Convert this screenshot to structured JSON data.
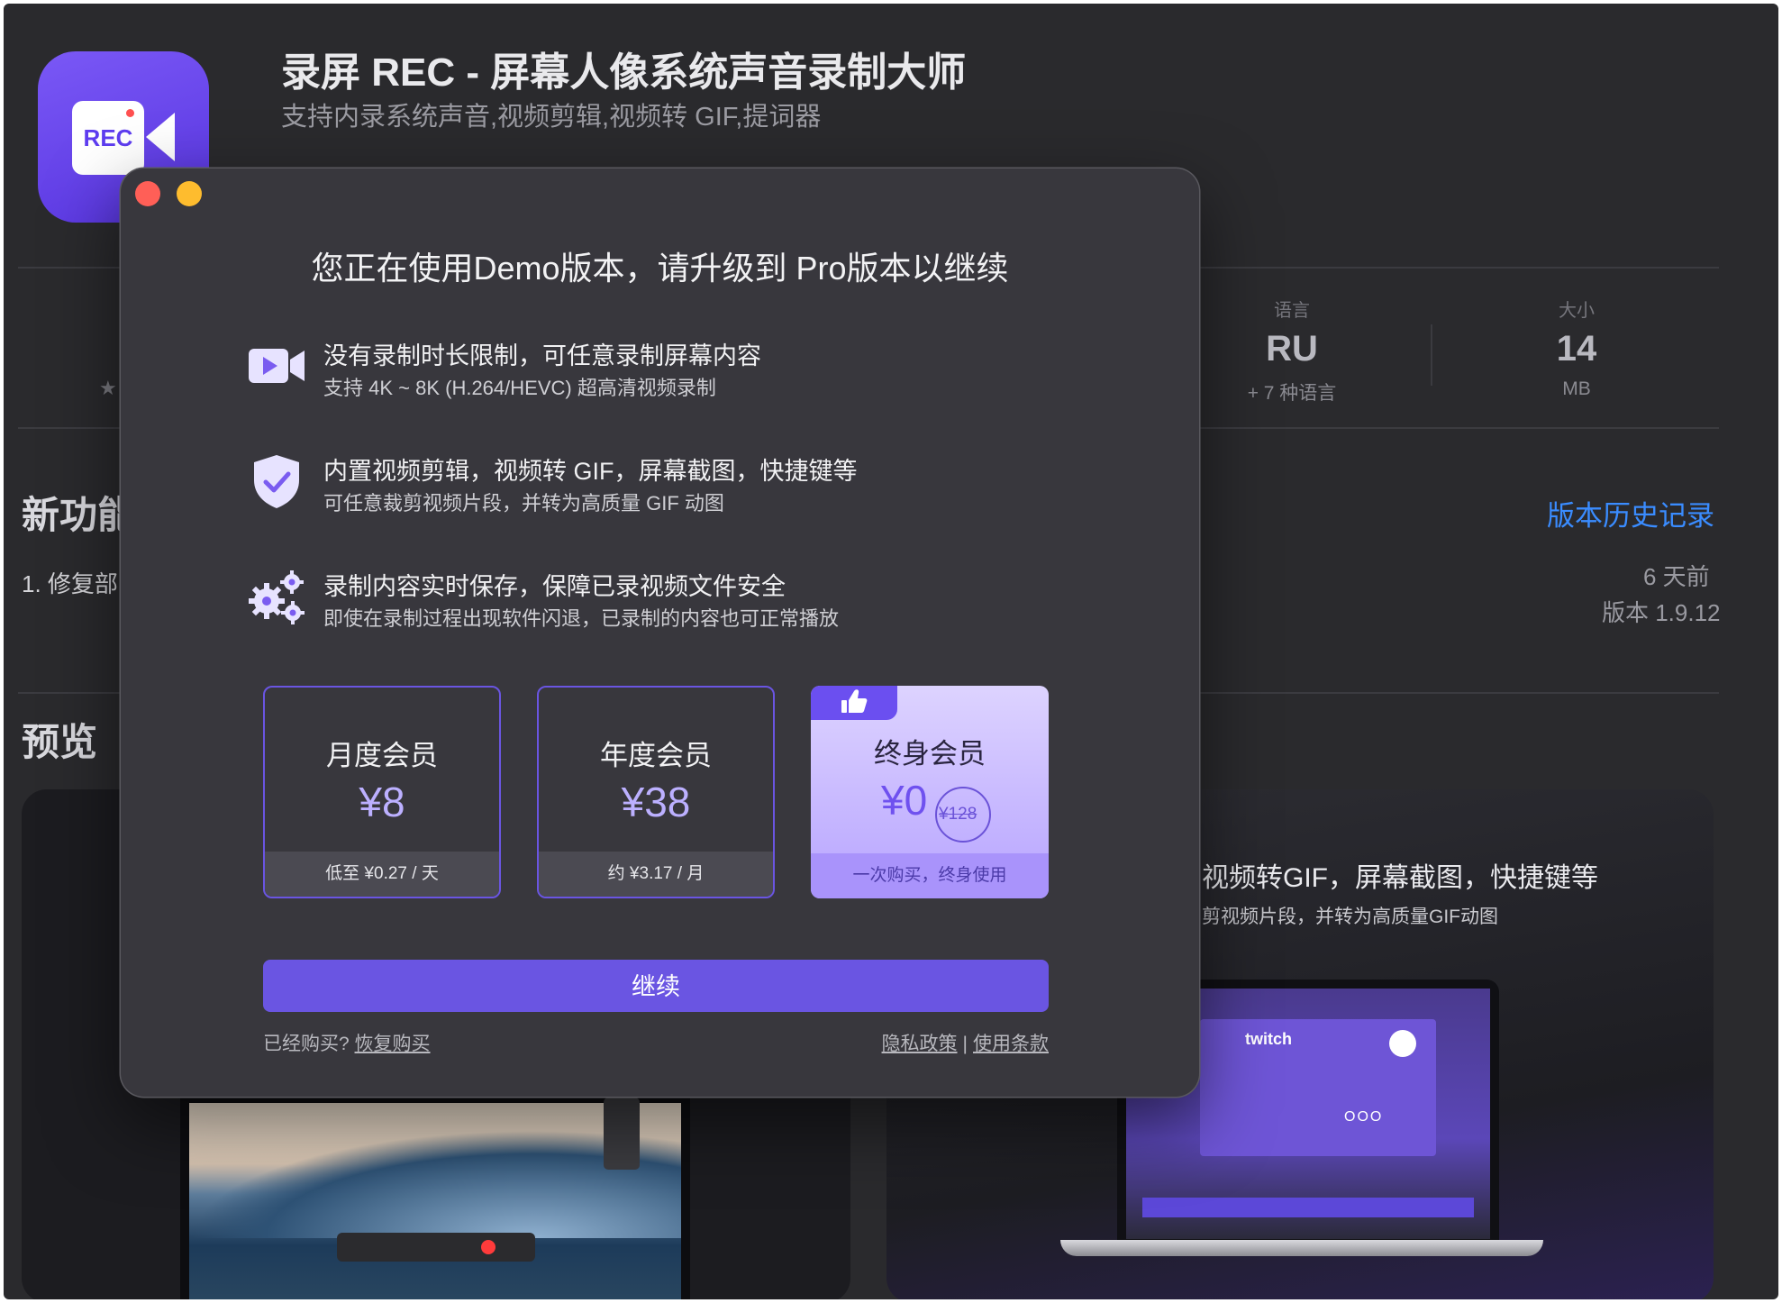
{
  "app": {
    "icon_text": "REC",
    "title": "录屏 REC - 屏幕人像系统声音录制大师",
    "subtitle": "支持内录系统声音,视频剪辑,视频转 GIF,提词器"
  },
  "stats": {
    "rating_star": "★",
    "language": {
      "label": "语言",
      "value": "RU",
      "sub": "+ 7 种语言"
    },
    "size": {
      "label": "大小",
      "value": "14",
      "sub": "MB"
    }
  },
  "whats_new": {
    "title": "新功能",
    "history_link": "版本历史记录",
    "first_item": "1. 修复部",
    "ago": "6 天前",
    "version": "版本 1.9.12"
  },
  "preview": {
    "title": "预览",
    "right_tile": {
      "heading": "视频转GIF，屏幕截图，快捷键等",
      "subheading": "剪视频片段，并转为高质量GIF动图"
    },
    "laptop_logo": "twitch",
    "laptop_dots": "OOO"
  },
  "modal": {
    "heading": "您正在使用Demo版本，请升级到 Pro版本以继续",
    "features": [
      {
        "icon": "video-camera-icon",
        "title": "没有录制时长限制，可任意录制屏幕内容",
        "desc": "支持 4K ~ 8K (H.264/HEVC) 超高清视频录制"
      },
      {
        "icon": "shield-check-icon",
        "title": "内置视频剪辑，视频转 GIF，屏幕截图，快捷键等",
        "desc": "可任意裁剪视频片段，并转为高质量 GIF 动图"
      },
      {
        "icon": "gears-icon",
        "title": "录制内容实时保存，保障已录视频文件安全",
        "desc": "即使在录制过程出现软件闪退，已录制的内容也可正常播放"
      }
    ],
    "plans": [
      {
        "name": "月度会员",
        "price": "¥8",
        "foot": "低至 ¥0.27 / 天"
      },
      {
        "name": "年度会员",
        "price": "¥38",
        "foot": "约 ¥3.17 / 月"
      },
      {
        "name": "终身会员",
        "price": "¥0",
        "original_price": "¥128",
        "foot": "一次购买，终身使用",
        "badge_icon": "thumbs-up-icon"
      }
    ],
    "continue_label": "继续",
    "already_bought": "已经购买?",
    "restore_link": "恢复购买",
    "privacy_link": "隐私政策",
    "separator": "|",
    "terms_link": "使用条款"
  },
  "colors": {
    "accent": "#6a55e2",
    "link_blue": "#3a8cff",
    "modal_bg": "#38373d",
    "page_bg": "#2a2a2d"
  }
}
